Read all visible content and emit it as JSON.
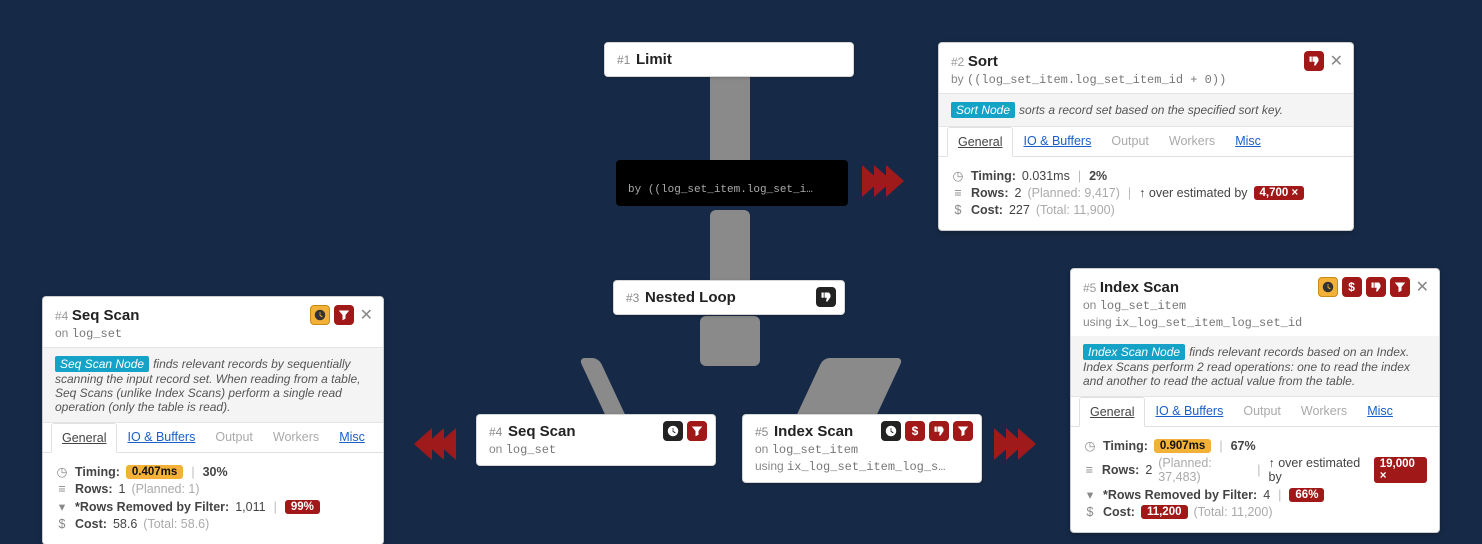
{
  "nodes": {
    "n1": {
      "idx": "#1",
      "title": "Limit"
    },
    "n2_compact": {
      "by_prefix": "by",
      "expr": "((log_set_item.log_set_i…"
    },
    "n3": {
      "idx": "#3",
      "title": "Nested Loop"
    },
    "n4": {
      "idx": "#4",
      "title": "Seq Scan",
      "on_prefix": "on",
      "on": "log_set"
    },
    "n5": {
      "idx": "#5",
      "title": "Index Scan",
      "on_prefix": "on",
      "on": "log_set_item",
      "using_prefix": "using",
      "using": "ix_log_set_item_log_s…"
    }
  },
  "panels": {
    "p2": {
      "idx": "#2",
      "title": "Sort",
      "by_prefix": "by",
      "by": "((log_set_item.log_set_item_id + 0))",
      "desc_tag": "Sort Node",
      "desc": "sorts a record set based on the specified sort key.",
      "tabs": {
        "general": "General",
        "io": "IO & Buffers",
        "output": "Output",
        "workers": "Workers",
        "misc": "Misc"
      },
      "timing_lbl": "Timing:",
      "timing": "0.031ms",
      "timing_pct": "2%",
      "rows_lbl": "Rows:",
      "rows": "2",
      "rows_planned": "(Planned: 9,417)",
      "rows_est_lbl": "↑ over estimated by",
      "rows_est_pill": "4,700 ×",
      "cost_lbl": "Cost:",
      "cost": "227",
      "cost_total": "(Total: 11,900)"
    },
    "p4": {
      "idx": "#4",
      "title": "Seq Scan",
      "on_prefix": "on",
      "on": "log_set",
      "desc_tag": "Seq Scan Node",
      "desc": "finds relevant records by sequentially scanning the input record set. When reading from a table, Seq Scans (unlike Index Scans) perform a single read operation (only the table is read).",
      "tabs": {
        "general": "General",
        "io": "IO & Buffers",
        "output": "Output",
        "workers": "Workers",
        "misc": "Misc"
      },
      "timing_lbl": "Timing:",
      "timing": "0.407ms",
      "timing_pct": "30%",
      "rows_lbl": "Rows:",
      "rows": "1",
      "rows_planned": "(Planned: 1)",
      "filter_lbl": "*Rows Removed by Filter:",
      "filter_val": "1,011",
      "filter_pill": "99%",
      "cost_lbl": "Cost:",
      "cost": "58.6",
      "cost_total": "(Total: 58.6)"
    },
    "p5": {
      "idx": "#5",
      "title": "Index Scan",
      "on_prefix": "on",
      "on": "log_set_item",
      "using_prefix": "using",
      "using": "ix_log_set_item_log_set_id",
      "desc_tag": "Index Scan Node",
      "desc": "finds relevant records based on an Index. Index Scans perform 2 read operations: one to read the index and another to read the actual value from the table.",
      "tabs": {
        "general": "General",
        "io": "IO & Buffers",
        "output": "Output",
        "workers": "Workers",
        "misc": "Misc"
      },
      "timing_lbl": "Timing:",
      "timing": "0.907ms",
      "timing_pct": "67%",
      "rows_lbl": "Rows:",
      "rows": "2",
      "rows_planned": "(Planned: 37,483)",
      "rows_est_lbl": "↑ over estimated by",
      "rows_est_pill": "19,000 ×",
      "filter_lbl": "*Rows Removed by Filter:",
      "filter_val": "4",
      "filter_pill": "66%",
      "cost_lbl": "Cost:",
      "cost_pill": "11,200",
      "cost_total": "(Total: 11,200)"
    }
  },
  "icon_names": {
    "thumb_down": "thumb-down-icon",
    "clock": "clock-icon",
    "filter": "filter-icon",
    "dollar": "dollar-icon",
    "close": "close-icon",
    "rows": "rows-icon",
    "cost": "cost-icon"
  }
}
